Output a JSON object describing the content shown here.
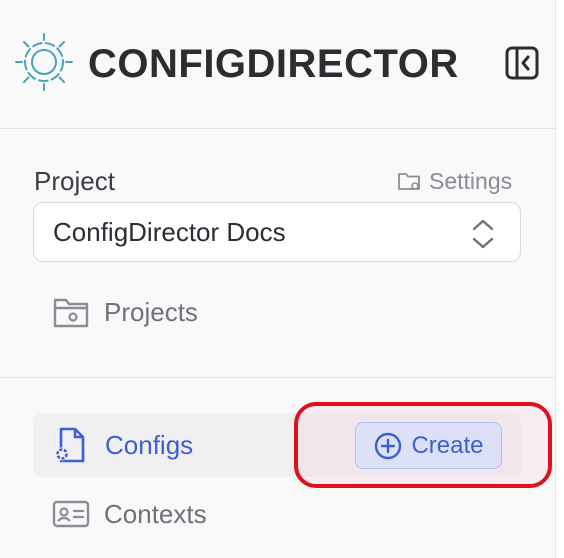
{
  "header": {
    "brand": "CONFIGDIRECTOR",
    "logo_icon": "gear-logo-icon",
    "collapse_icon": "sidebar-collapse-icon"
  },
  "project": {
    "label": "Project",
    "settings_label": "Settings",
    "selected": "ConfigDirector Docs",
    "projects_link": "Projects"
  },
  "nav": {
    "configs_label": "Configs",
    "create_label": "Create",
    "contexts_label": "Contexts"
  },
  "colors": {
    "accent": "#3d5fd6",
    "highlight": "#e0101e",
    "logo": "#4aa3b8"
  }
}
